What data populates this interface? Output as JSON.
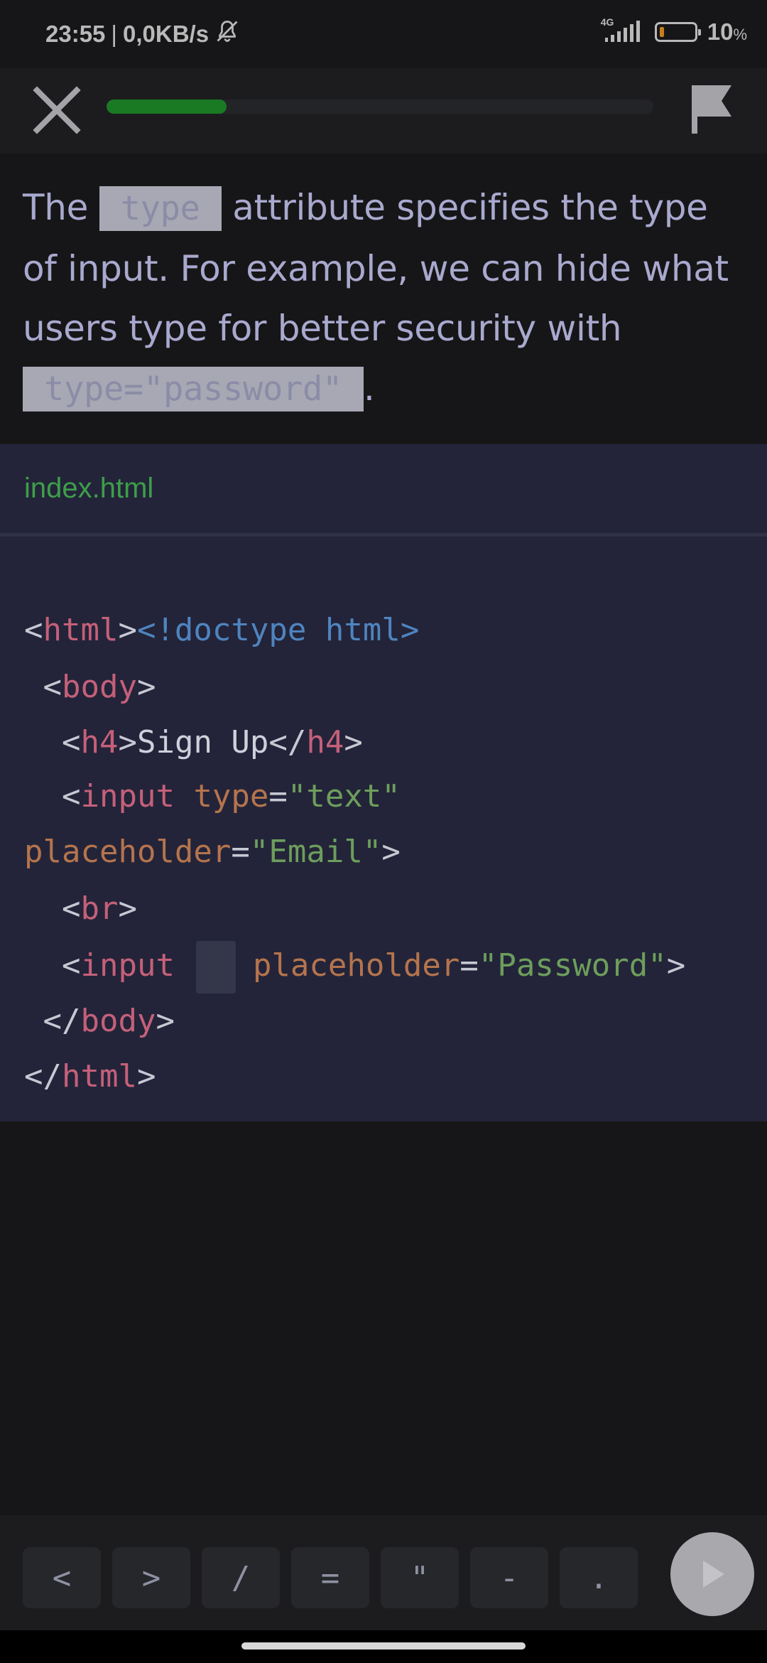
{
  "status_bar": {
    "time": "23:55",
    "separator": "|",
    "speed": "0,0KB/s",
    "network": "4G",
    "battery_percent": "10",
    "battery_pct_sign": "%"
  },
  "header": {
    "progress_fraction": 0.22,
    "progress_color": "#1a7a24"
  },
  "instruction": {
    "part1": "The ",
    "code1": "type",
    "part2": " attribute specifies the type of input. For example, we can hide what users type for better security with ",
    "code2": "type=\"password\"",
    "part3": "."
  },
  "editor": {
    "filename": "index.html",
    "lines": {
      "l1": "<!doctype html>",
      "l2_open": "<",
      "l2_tag": "html",
      "l2_close": ">",
      "l3_open": "<",
      "l3_tag": "body",
      "l3_close": ">",
      "l4_open": "<",
      "l4_tag": "h4",
      "l4_mid": ">",
      "l4_text": "Sign Up",
      "l4_end_open": "</",
      "l4_end_tag": "h4",
      "l4_end_close": ">",
      "l5_open": "<",
      "l5_tag": "input",
      "l5_attr": "type",
      "l5_eq": "=",
      "l5_val": "\"text\"",
      "l6_attr": "placeholder",
      "l6_eq": "=",
      "l6_val": "\"Email\"",
      "l6_close": ">",
      "l7_open": "<",
      "l7_tag": "br",
      "l7_close": ">",
      "l8_open": "<",
      "l8_tag": "input",
      "l8_attr": "placeholder",
      "l8_eq": "=",
      "l8_val": "\"Password\"",
      "l8_close": ">",
      "l9_open": "</",
      "l9_tag": "body",
      "l9_close": ">",
      "l10_open": "</",
      "l10_tag": "html",
      "l10_close": ">"
    }
  },
  "keys": {
    "k1": "<",
    "k2": ">",
    "k3": "/",
    "k4": "=",
    "k5": "\"",
    "k6": "-",
    "k7": "."
  }
}
